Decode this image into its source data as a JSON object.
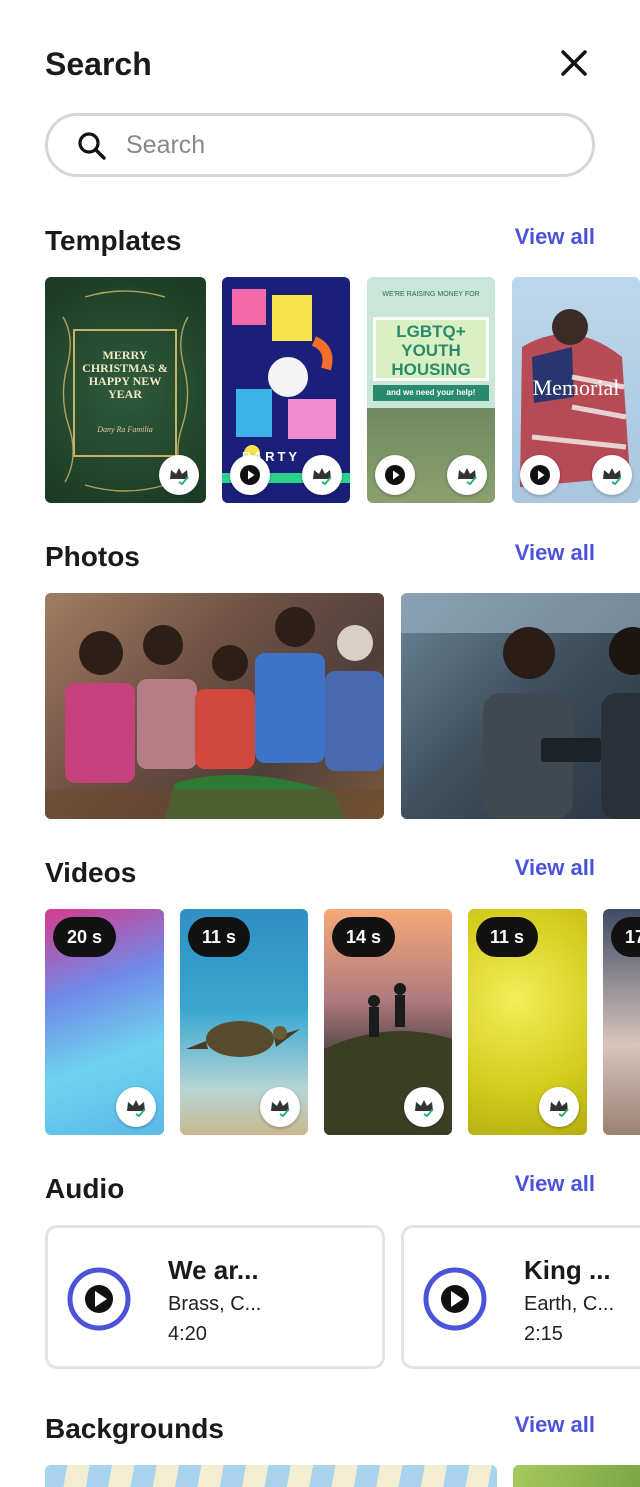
{
  "header": {
    "title": "Search"
  },
  "search": {
    "placeholder": "Search",
    "value": ""
  },
  "templates": {
    "title": "Templates",
    "view_all": "View all",
    "items": [
      {
        "name": "merry-christmas",
        "text": "MERRY CHRISTMAS & HAPPY NEW YEAR",
        "signature": "Dany Ra Familia",
        "video": false,
        "premium": true
      },
      {
        "name": "lgbt-block-party",
        "text": "PARTY",
        "video": true,
        "premium": true
      },
      {
        "name": "lgbtq-youth-housing",
        "small": "WE'RE RAISING MONEY FOR",
        "title": "LGBTQ+ YOUTH HOUSING",
        "subtitle": "and we need your help!",
        "video": true,
        "premium": true
      },
      {
        "name": "memorial",
        "text": "Memorial",
        "video": true,
        "premium": true
      }
    ]
  },
  "photos": {
    "title": "Photos",
    "view_all": "View all"
  },
  "videos": {
    "title": "Videos",
    "view_all": "View all",
    "items": [
      {
        "duration": "20 s",
        "premium": true
      },
      {
        "duration": "11 s",
        "premium": true
      },
      {
        "duration": "14 s",
        "premium": true
      },
      {
        "duration": "11 s",
        "premium": true
      },
      {
        "duration": "17",
        "premium": false
      }
    ]
  },
  "audio": {
    "title": "Audio",
    "view_all": "View all",
    "items": [
      {
        "title": "We ar...",
        "artist": "Brass, C...",
        "duration": "4:20"
      },
      {
        "title": "King ...",
        "artist": "Earth, C...",
        "duration": "2:15"
      }
    ]
  },
  "backgrounds": {
    "title": "Backgrounds",
    "view_all": "View all"
  },
  "colors": {
    "accent": "#4b53d8",
    "text": "#1a1a1a",
    "border": "#d6d6d6"
  }
}
